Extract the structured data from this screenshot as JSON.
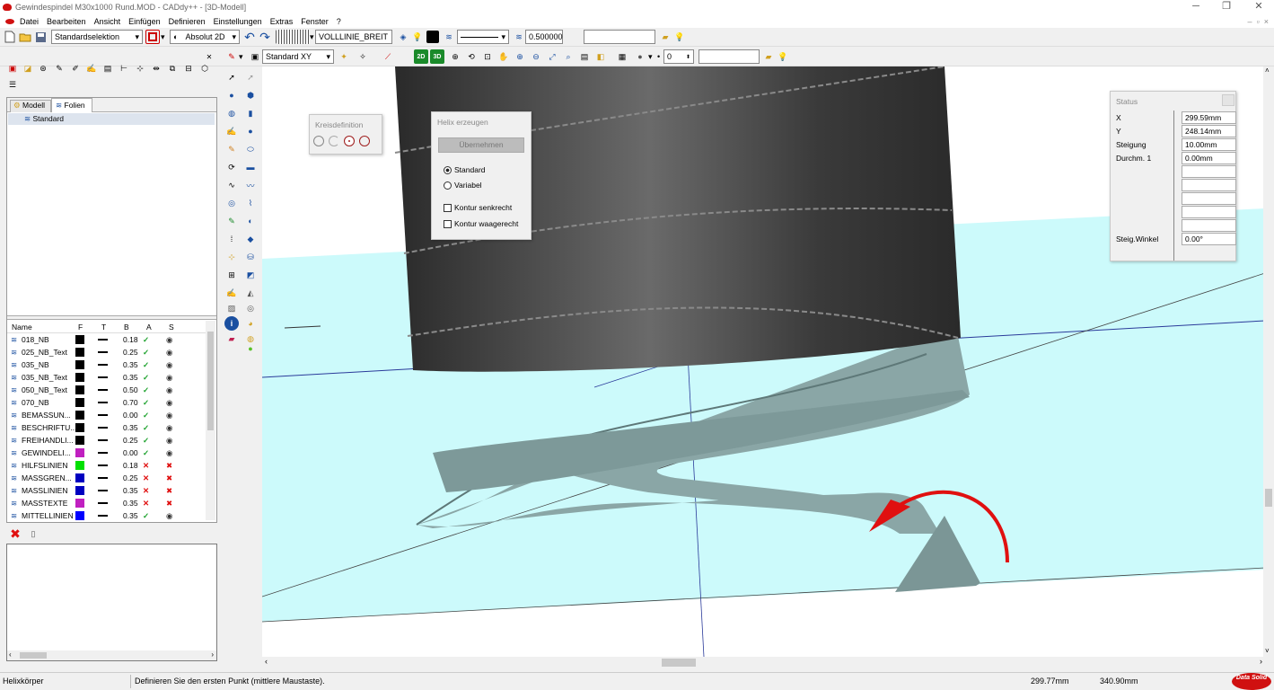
{
  "window": {
    "title": "Gewindespindel M30x1000 Rund.MOD  -  CADdy++ - [3D-Modell]"
  },
  "menu": [
    "Datei",
    "Bearbeiten",
    "Ansicht",
    "Einfügen",
    "Definieren",
    "Einstellungen",
    "Extras",
    "Fenster",
    "?"
  ],
  "toolbar1": {
    "selection": "Standardselektion",
    "coord_mode": "Absolut 2D",
    "linetype": "VOLLLINIE_BREIT",
    "linewidth": "0.500000",
    "text_field": ""
  },
  "toolbar2": {
    "view": "Standard XY",
    "value": "0",
    "field": ""
  },
  "panel": {
    "tabs": [
      "Modell",
      "Folien"
    ],
    "tree_item": "Standard",
    "columns": [
      "Name",
      "F",
      "T",
      "B",
      "A",
      "S"
    ],
    "layers": [
      {
        "name": "018_NB",
        "color": "#000000",
        "width": "0.18",
        "active": true
      },
      {
        "name": "025_NB_Text",
        "color": "#000000",
        "width": "0.25",
        "active": true
      },
      {
        "name": "035_NB",
        "color": "#000000",
        "width": "0.35",
        "active": true
      },
      {
        "name": "035_NB_Text",
        "color": "#000000",
        "width": "0.35",
        "active": true
      },
      {
        "name": "050_NB_Text",
        "color": "#000000",
        "width": "0.50",
        "active": true
      },
      {
        "name": "070_NB",
        "color": "#000000",
        "width": "0.70",
        "active": true
      },
      {
        "name": "BEMASSUN...",
        "color": "#000000",
        "width": "0.00",
        "active": true
      },
      {
        "name": "BESCHRIFTU...",
        "color": "#000000",
        "width": "0.35",
        "active": true
      },
      {
        "name": "FREIHANDLI...",
        "color": "#000000",
        "width": "0.25",
        "active": true
      },
      {
        "name": "GEWINDELI...",
        "color": "#c020c0",
        "width": "0.00",
        "active": true
      },
      {
        "name": "HILFSLINIEN",
        "color": "#00e000",
        "width": "0.18",
        "active": false
      },
      {
        "name": "MASSGREN...",
        "color": "#0000c0",
        "width": "0.25",
        "active": false
      },
      {
        "name": "MASSLINIEN",
        "color": "#0000c0",
        "width": "0.35",
        "active": false
      },
      {
        "name": "MASSTEXTE",
        "color": "#c020c0",
        "width": "0.35",
        "active": false
      },
      {
        "name": "MITTELLINIEN",
        "color": "#0000ff",
        "width": "0.35",
        "active": true
      }
    ]
  },
  "kreis_dialog": {
    "title": "Kreisdefinition"
  },
  "helix_dialog": {
    "title": "Helix erzeugen",
    "apply_button": "Übernehmen",
    "radio_standard": "Standard",
    "radio_variabel": "Variabel",
    "check_senkrecht": "Kontur senkrecht",
    "check_waagerecht": "Kontur waagerecht"
  },
  "status_panel": {
    "title": "Status",
    "rows": [
      {
        "label": "X",
        "value": "299.59mm"
      },
      {
        "label": "Y",
        "value": "248.14mm"
      },
      {
        "label": "Steigung",
        "value": "10.00mm"
      },
      {
        "label": "Durchm. 1",
        "value": "0.00mm"
      },
      {
        "label": "",
        "value": ""
      },
      {
        "label": "",
        "value": ""
      },
      {
        "label": "",
        "value": ""
      },
      {
        "label": "",
        "value": ""
      },
      {
        "label": "",
        "value": ""
      },
      {
        "label": "Steig.Winkel",
        "value": "0.00°"
      }
    ]
  },
  "statusbar": {
    "mode": "Helixkörper",
    "hint": "Definieren Sie den ersten Punkt (mittlere Maustaste).",
    "x": "299.77mm",
    "y": "340.90mm",
    "logo": "Data Solid"
  },
  "colors": {
    "viewport_plane": "#ccfafb",
    "spindle": "#3a3a3a",
    "helix": "#7f9a9a",
    "arrow": "#e01010"
  }
}
